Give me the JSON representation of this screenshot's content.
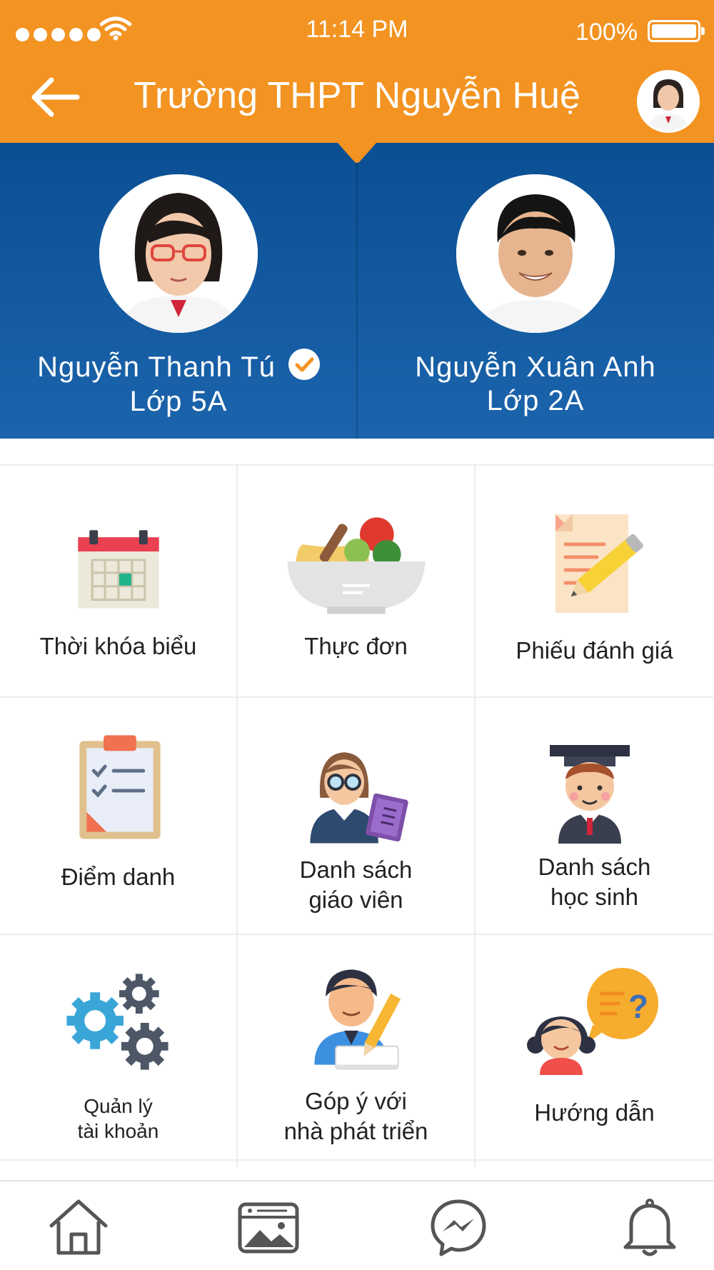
{
  "status_bar": {
    "time": "11:14 PM",
    "battery": "100%"
  },
  "header": {
    "title": "Trường THPT Nguyễn Huệ"
  },
  "students": [
    {
      "name": "Nguyễn Thanh Tú",
      "class": "Lớp 5A",
      "selected": true
    },
    {
      "name": "Nguyễn Xuân Anh",
      "class": "Lớp 2A",
      "selected": false
    }
  ],
  "menu": {
    "timetable": "Thời khóa biểu",
    "menu_food": "Thực đơn",
    "evaluation": "Phiếu đánh giá",
    "attendance": "Điểm danh",
    "teachers_l1": "Danh sách",
    "teachers_l2": "giáo viên",
    "students_l1": "Danh sách",
    "students_l2": "học sinh",
    "account_l1": "Quản lý",
    "account_l2": "tài khoản",
    "feedback_l1": "Góp ý với",
    "feedback_l2": "nhà phát triển",
    "guide": "Hướng dẫn"
  },
  "colors": {
    "header": "#f39321",
    "student_panel": "#0b4f93",
    "accent": "#f39321"
  },
  "icons": [
    "back-arrow-icon",
    "calendar-icon",
    "food-bowl-icon",
    "document-pencil-icon",
    "clipboard-checklist-icon",
    "teacher-icon",
    "graduate-student-icon",
    "gears-icon",
    "feedback-person-icon",
    "help-girl-icon",
    "home-icon",
    "gallery-icon",
    "messenger-icon",
    "bell-icon"
  ]
}
